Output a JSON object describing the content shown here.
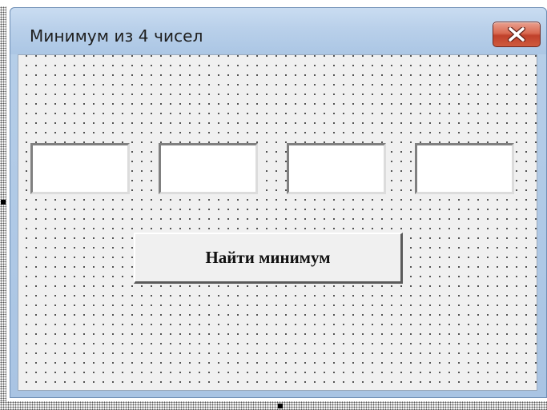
{
  "window": {
    "title": "Минимум из 4 чисел",
    "close_icon": "close-icon"
  },
  "inputs": [
    {
      "value": "",
      "placeholder": ""
    },
    {
      "value": "",
      "placeholder": ""
    },
    {
      "value": "",
      "placeholder": ""
    },
    {
      "value": "",
      "placeholder": ""
    }
  ],
  "find_button": {
    "label": "Найти минимум"
  },
  "colors": {
    "client_background": "#f0f0f0",
    "title_bar": "#b9d0ea",
    "close_button": "#c0412b"
  }
}
